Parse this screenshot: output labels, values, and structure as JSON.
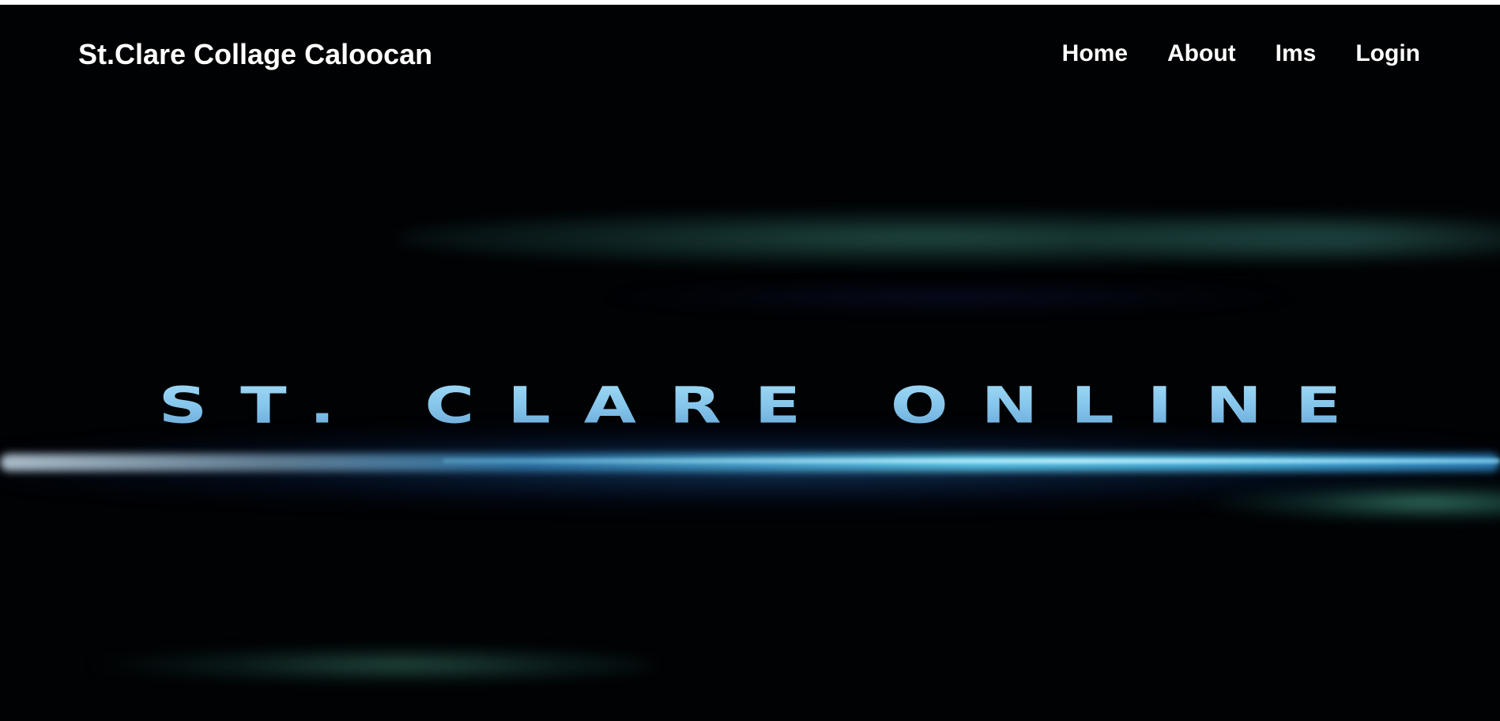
{
  "navbar": {
    "brand": "St.Clare Collage Caloocan",
    "links": [
      {
        "label": "Home"
      },
      {
        "label": "About"
      },
      {
        "label": "Ims"
      },
      {
        "label": "Login"
      }
    ]
  },
  "hero": {
    "title": "ST. CLARE ONLINE"
  },
  "colors": {
    "background": "#010204",
    "nav_text": "#ffffff",
    "title_light": "#9fd9f5",
    "title_dark": "#6aa8d8",
    "streak_blue": "#5ac8eb",
    "streak_teal": "#5ac8aa"
  }
}
